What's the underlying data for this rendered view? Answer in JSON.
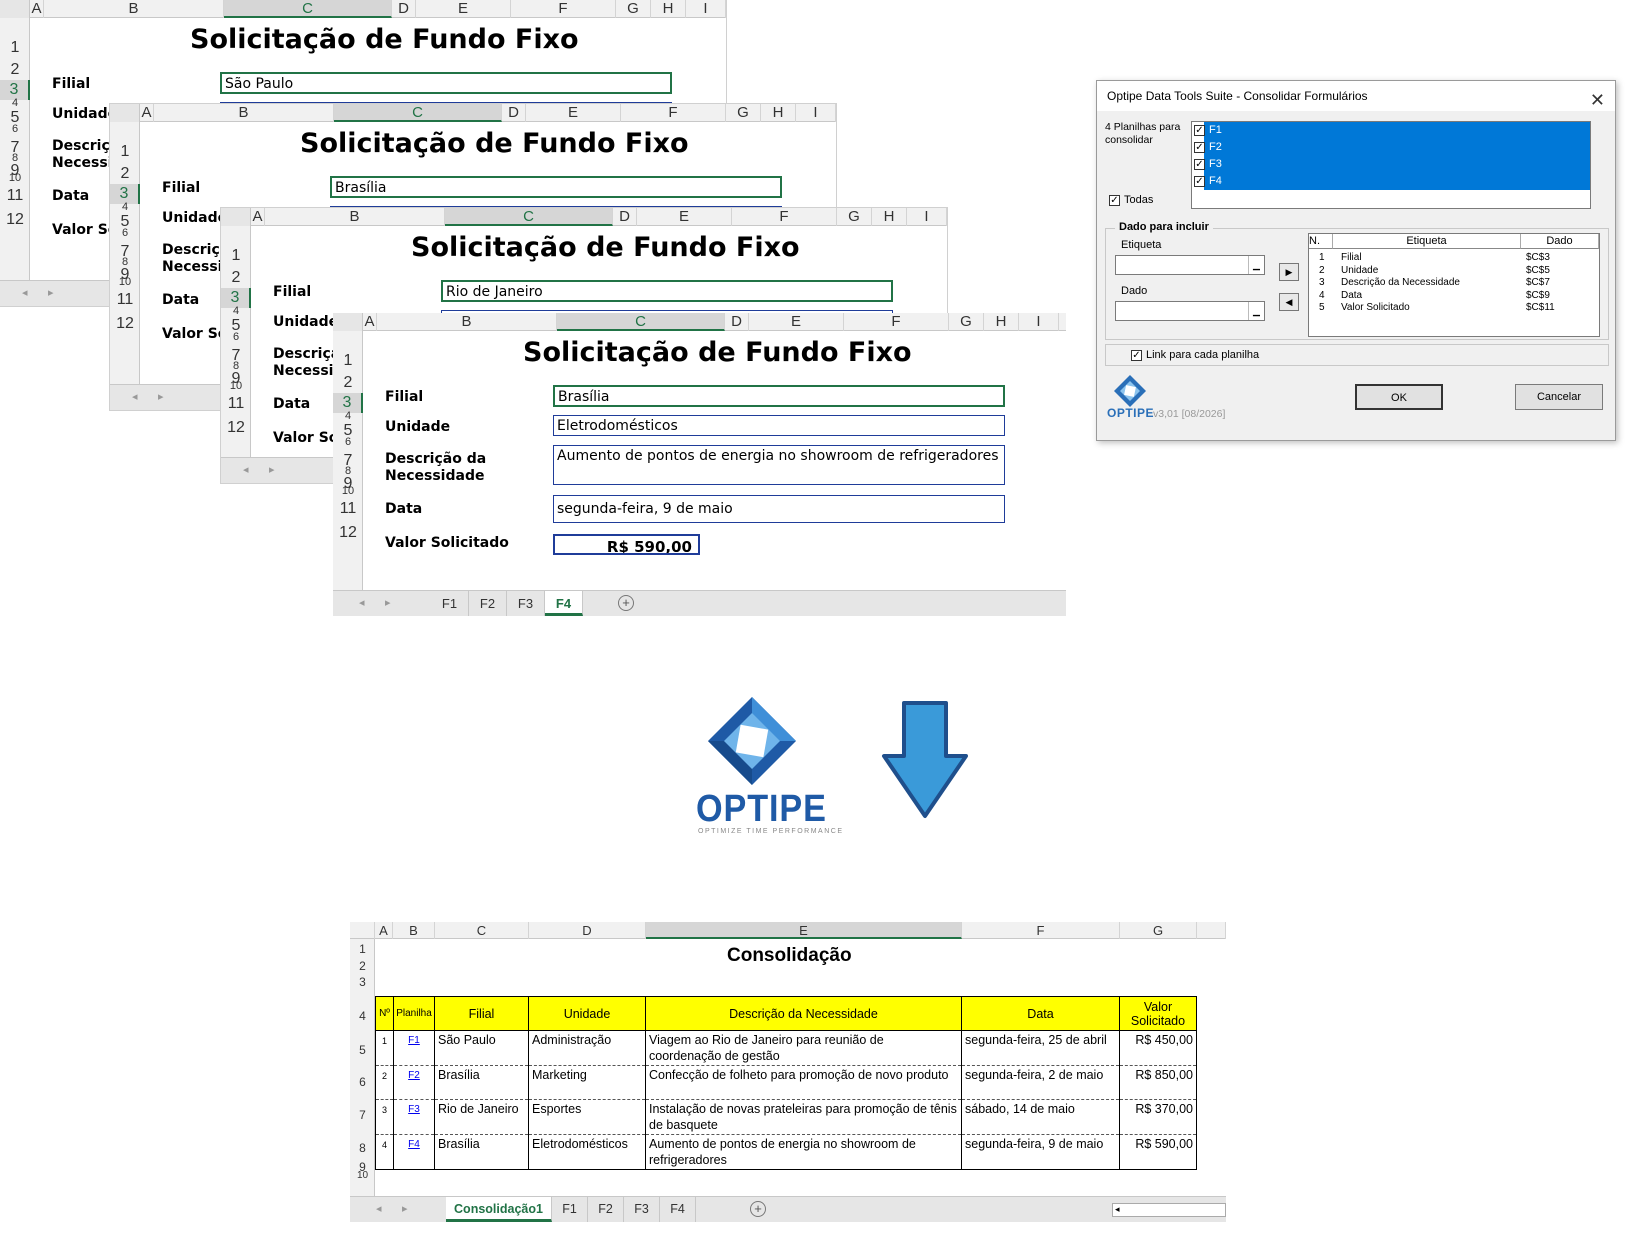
{
  "form": {
    "title": "Solicitação de Fundo Fixo",
    "labels": {
      "filial": "Filial",
      "unidade": "Unidade",
      "descricao": "Descrição da Necessidade",
      "data": "Data",
      "valor": "Valor Solicitado"
    },
    "columns": [
      "A",
      "B",
      "C",
      "D",
      "E",
      "F",
      "G",
      "H",
      "I"
    ],
    "rows": [
      "1",
      "2",
      "3",
      "4",
      "5",
      "6",
      "7",
      "8",
      "9",
      "10",
      "11",
      "12"
    ]
  },
  "sheets": [
    {
      "filial": "São Paulo"
    },
    {
      "filial": "Brasília"
    },
    {
      "filial": "Rio de Janeiro"
    },
    {
      "filial": "Brasília",
      "unidade": "Eletrodomésticos",
      "descricao": "Aumento de pontos de energia no showroom de refrigeradores",
      "data": "segunda-feira, 9 de maio",
      "valor": "R$ 590,00"
    }
  ],
  "sheet_tabs": [
    "F1",
    "F2",
    "F3",
    "F4"
  ],
  "active_sheet_tab": "F4",
  "dialog": {
    "title": "Optipe Data Tools Suite - Consolidar Formulários",
    "sheets_caption": "4 Planilhas para consolidar",
    "sheet_list": [
      "F1",
      "F2",
      "F3",
      "F4"
    ],
    "all_label": "Todas",
    "group_label": "Dado para incluir",
    "etiqueta_label": "Etiqueta",
    "dado_label": "Dado",
    "table_headers": [
      "N.",
      "Etiqueta",
      "Dado"
    ],
    "table_rows": [
      {
        "n": "1",
        "etiqueta": "Filial",
        "dado": "$C$3"
      },
      {
        "n": "2",
        "etiqueta": "Unidade",
        "dado": "$C$5"
      },
      {
        "n": "3",
        "etiqueta": "Descrição da Necessidade",
        "dado": "$C$7"
      },
      {
        "n": "4",
        "etiqueta": "Data",
        "dado": "$C$9"
      },
      {
        "n": "5",
        "etiqueta": "Valor Solicitado",
        "dado": "$C$11"
      }
    ],
    "link_label": "Link para cada planilha",
    "logo_text": "OPTIPE",
    "version": "v3,01 [08/2026]",
    "ok_label": "OK",
    "cancel_label": "Cancelar"
  },
  "logo": {
    "text": "OPTIPE",
    "tagline": "OPTIMIZE TIME PERFORMANCE"
  },
  "colors": {
    "excel_green": "#217346",
    "arrow_blue": "#3a9ad9",
    "header_yellow": "#ffff00",
    "selection_blue": "#0078d7"
  },
  "consolidation": {
    "title": "Consolidação",
    "columns": [
      "A",
      "B",
      "C",
      "D",
      "E",
      "F",
      "G"
    ],
    "rows": [
      "1",
      "2",
      "3",
      "4",
      "5",
      "6",
      "7",
      "8",
      "9",
      "10"
    ],
    "headers": [
      "Nº",
      "Planilha",
      "Filial",
      "Unidade",
      "Descrição da Necessidade",
      "Data",
      "Valor Solicitado"
    ],
    "data": [
      {
        "n": "1",
        "planilha": "F1",
        "filial": "São Paulo",
        "unidade": "Administração",
        "descricao": "Viagem ao Rio de Janeiro para reunião de coordenação de gestão",
        "data": "segunda-feira, 25 de abril",
        "valor": "R$ 450,00"
      },
      {
        "n": "2",
        "planilha": "F2",
        "filial": "Brasília",
        "unidade": "Marketing",
        "descricao": "Confecção de folheto para promoção de novo produto",
        "data": "segunda-feira, 2 de maio",
        "valor": "R$ 850,00"
      },
      {
        "n": "3",
        "planilha": "F3",
        "filial": "Rio de Janeiro",
        "unidade": "Esportes",
        "descricao": "Instalação de novas prateleiras para promoção de tênis de basquete",
        "data": "sábado, 14 de maio",
        "valor": "R$ 370,00"
      },
      {
        "n": "4",
        "planilha": "F4",
        "filial": "Brasília",
        "unidade": "Eletrodomésticos",
        "descricao": "Aumento de pontos de energia no showroom de refrigeradores",
        "data": "segunda-feira, 9 de maio",
        "valor": "R$ 590,00"
      }
    ],
    "tabs": [
      "Consolidação1",
      "F1",
      "F2",
      "F3",
      "F4"
    ],
    "active_tab": "Consolidação1"
  }
}
